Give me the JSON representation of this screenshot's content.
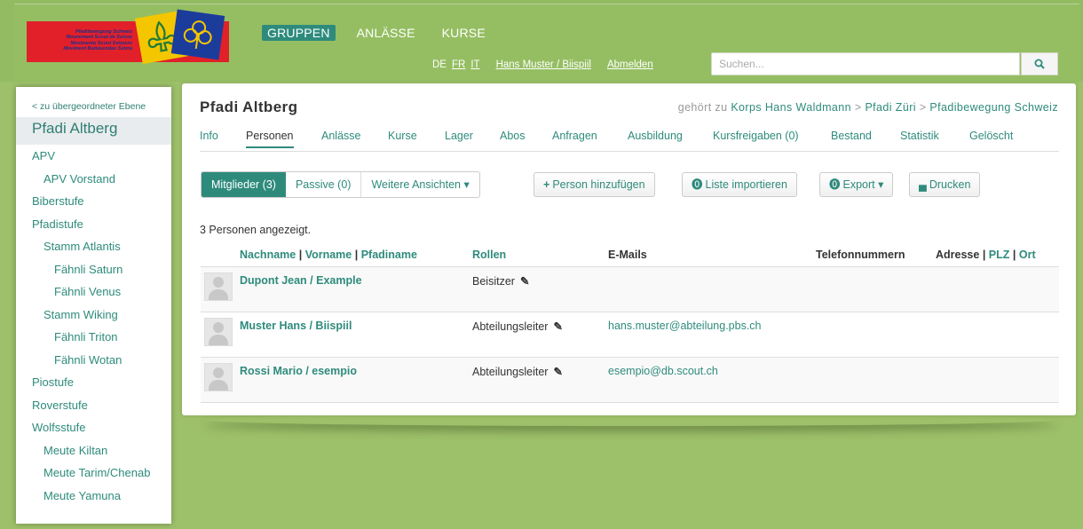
{
  "logo": {
    "lines": [
      "Pfadibewegung Schweiz",
      "Mouvement Scout de Suisse",
      "Movimento Scout Svizzero",
      "Moviment Battasendas Svizra"
    ]
  },
  "mainnav": [
    "GRUPPEN",
    "ANLÄSSE",
    "KURSE"
  ],
  "languages": [
    "DE",
    "FR",
    "IT"
  ],
  "user": "Hans Muster / Biispiil",
  "logout": "Abmelden",
  "search": {
    "placeholder": "Suchen..."
  },
  "sidebar": {
    "back": "< zu übergeordneter Ebene",
    "current": "Pfadi Altberg",
    "items": [
      {
        "label": "APV",
        "level": 0
      },
      {
        "label": "APV Vorstand",
        "level": 1
      },
      {
        "label": "Biberstufe",
        "level": 0
      },
      {
        "label": "Pfadistufe",
        "level": 0
      },
      {
        "label": "Stamm Atlantis",
        "level": 1
      },
      {
        "label": "Fähnli Saturn",
        "level": 2
      },
      {
        "label": "Fähnli Venus",
        "level": 2
      },
      {
        "label": "Stamm Wiking",
        "level": 1
      },
      {
        "label": "Fähnli Triton",
        "level": 2
      },
      {
        "label": "Fähnli Wotan",
        "level": 2
      },
      {
        "label": "Piostufe",
        "level": 0
      },
      {
        "label": "Roverstufe",
        "level": 0
      },
      {
        "label": "Wolfsstufe",
        "level": 0
      },
      {
        "label": "Meute Kiltan",
        "level": 1
      },
      {
        "label": "Meute Tarim/Chenab",
        "level": 1
      },
      {
        "label": "Meute Yamuna",
        "level": 1
      }
    ]
  },
  "page": {
    "title": "Pfadi Altberg",
    "belongs_label": "gehört zu",
    "crumbs": [
      "Korps Hans Waldmann",
      "Pfadi Züri",
      "Pfadibewegung Schweiz"
    ],
    "tabs": [
      "Info",
      "Personen",
      "Anlässe",
      "Kurse",
      "Lager",
      "Abos",
      "Anfragen",
      "Ausbildung",
      "Kursfreigaben (0)",
      "Bestand",
      "Statistik",
      "Gelöscht"
    ],
    "filters": [
      "Mitglieder (3)",
      "Passive (0)",
      "Weitere Ansichten"
    ],
    "buttons": {
      "add": "Person hinzufügen",
      "import": "Liste importieren",
      "export": "Export",
      "print": "Drucken"
    },
    "count": "3 Personen angezeigt.",
    "columns": {
      "nachname": "Nachname",
      "vorname": "Vorname",
      "pfadiname": "Pfadiname",
      "rollen": "Rollen",
      "emails": "E-Mails",
      "telefon": "Telefonnummern",
      "adresse": "Adresse",
      "plz": "PLZ",
      "ort": "Ort"
    },
    "rows": [
      {
        "name": "Dupont Jean / Example",
        "role": "Beisitzer",
        "email": ""
      },
      {
        "name": "Muster Hans / Biispiil",
        "role": "Abteilungsleiter",
        "email": "hans.muster@abteilung.pbs.ch"
      },
      {
        "name": "Rossi Mario / esempio",
        "role": "Abteilungsleiter",
        "email": "esempio@db.scout.ch"
      }
    ]
  }
}
